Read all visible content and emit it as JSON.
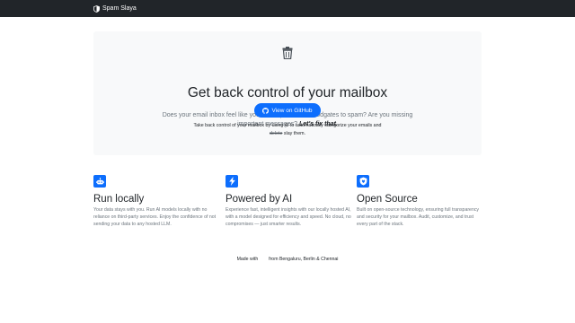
{
  "navbar": {
    "brand": "Spam Slaya",
    "brand_icon": "shield-half-icon",
    "background": "#212529"
  },
  "hero": {
    "icon": "trash-icon",
    "title": "Get back control of your mailbox",
    "lead": "Does your email inbox feel like you have opened the floodgates to spam? Are you missing important messages?",
    "lead_emphasis": "Let's fix that.",
    "button_label": "View on GitHub",
    "button_icon": "github-icon",
    "small_text": "Take back control of your mailbox by using AI to automatically categorize your emails and",
    "small_struck": "delete",
    "small_end": "slay them.",
    "accent": "#0d6efd"
  },
  "features": [
    {
      "icon": "robot-icon",
      "title": "Run locally",
      "text": "Your data stays with you. Run AI models locally with no reliance on third-party services. Enjoy the confidence of not sending your data to any hosted LLM."
    },
    {
      "icon": "lightning-icon",
      "title": "Powered by AI",
      "text": "Experience fast, intelligent insights with our locally hosted AI, with a model designed for efficiency and speed. No cloud, no compromises — just smarter results."
    },
    {
      "icon": "shield-heart-icon",
      "title": "Open Source",
      "text": "Built on open-source technology, ensuring full transparency and security for your mailbox. Audit, customize, and trust every part of the stack."
    }
  ],
  "footer": {
    "made_with": "Made with",
    "heart_icon": "heart-icon",
    "from": "from Bengaluru, Berlin & Chennai"
  }
}
